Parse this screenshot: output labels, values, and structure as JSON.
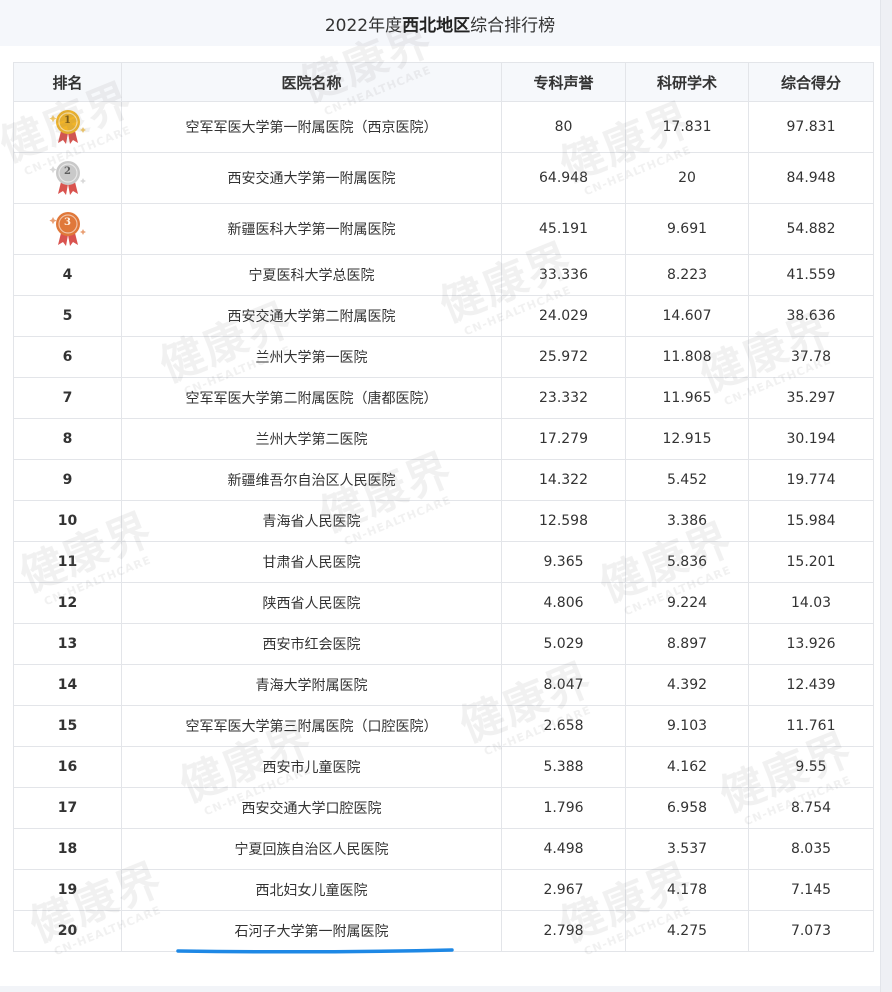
{
  "title": {
    "year": "2022年度",
    "region": "西北地区",
    "suffix": "综合排行榜"
  },
  "table": {
    "headers": {
      "rank": "排名",
      "hospital": "医院名称",
      "specialty": "专科声誉",
      "research": "科研学术",
      "total": "综合得分"
    },
    "rows": [
      {
        "rank": "1",
        "name": "空军军医大学第一附属医院（西京医院）",
        "specialty": "80",
        "research": "17.831",
        "total": "97.831"
      },
      {
        "rank": "2",
        "name": "西安交通大学第一附属医院",
        "specialty": "64.948",
        "research": "20",
        "total": "84.948"
      },
      {
        "rank": "3",
        "name": "新疆医科大学第一附属医院",
        "specialty": "45.191",
        "research": "9.691",
        "total": "54.882"
      },
      {
        "rank": "4",
        "name": "宁夏医科大学总医院",
        "specialty": "33.336",
        "research": "8.223",
        "total": "41.559"
      },
      {
        "rank": "5",
        "name": "西安交通大学第二附属医院",
        "specialty": "24.029",
        "research": "14.607",
        "total": "38.636"
      },
      {
        "rank": "6",
        "name": "兰州大学第一医院",
        "specialty": "25.972",
        "research": "11.808",
        "total": "37.78"
      },
      {
        "rank": "7",
        "name": "空军军医大学第二附属医院（唐都医院）",
        "specialty": "23.332",
        "research": "11.965",
        "total": "35.297"
      },
      {
        "rank": "8",
        "name": "兰州大学第二医院",
        "specialty": "17.279",
        "research": "12.915",
        "total": "30.194"
      },
      {
        "rank": "9",
        "name": "新疆维吾尔自治区人民医院",
        "specialty": "14.322",
        "research": "5.452",
        "total": "19.774"
      },
      {
        "rank": "10",
        "name": "青海省人民医院",
        "specialty": "12.598",
        "research": "3.386",
        "total": "15.984"
      },
      {
        "rank": "11",
        "name": "甘肃省人民医院",
        "specialty": "9.365",
        "research": "5.836",
        "total": "15.201"
      },
      {
        "rank": "12",
        "name": "陕西省人民医院",
        "specialty": "4.806",
        "research": "9.224",
        "total": "14.03"
      },
      {
        "rank": "13",
        "name": "西安市红会医院",
        "specialty": "5.029",
        "research": "8.897",
        "total": "13.926"
      },
      {
        "rank": "14",
        "name": "青海大学附属医院",
        "specialty": "8.047",
        "research": "4.392",
        "total": "12.439"
      },
      {
        "rank": "15",
        "name": "空军军医大学第三附属医院（口腔医院）",
        "specialty": "2.658",
        "research": "9.103",
        "total": "11.761"
      },
      {
        "rank": "16",
        "name": "西安市儿童医院",
        "specialty": "5.388",
        "research": "4.162",
        "total": "9.55"
      },
      {
        "rank": "17",
        "name": "西安交通大学口腔医院",
        "specialty": "1.796",
        "research": "6.958",
        "total": "8.754"
      },
      {
        "rank": "18",
        "name": "宁夏回族自治区人民医院",
        "specialty": "4.498",
        "research": "3.537",
        "total": "8.035"
      },
      {
        "rank": "19",
        "name": "西北妇女儿童医院",
        "specialty": "2.967",
        "research": "4.178",
        "total": "7.145"
      },
      {
        "rank": "20",
        "name": "石河子大学第一附属医院",
        "specialty": "2.798",
        "research": "4.275",
        "total": "7.073"
      }
    ]
  },
  "medals": {
    "gold": "#f0b429",
    "silver": "#c9c9c9",
    "bronze": "#e0783a",
    "ribbon": "#d9534f"
  },
  "watermark": {
    "main": "健康界",
    "sub": "CN-HEALTHCARE"
  },
  "highlight_color": "#1e88e5"
}
